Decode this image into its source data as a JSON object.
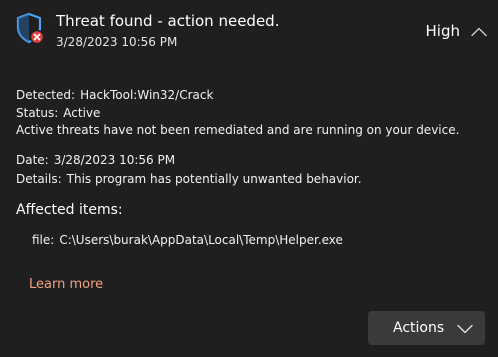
{
  "notification": {
    "title": "Threat found - action needed.",
    "timestamp": "3/28/2023 10:56 PM",
    "severity": "High",
    "icon": "shield-error-icon",
    "collapse_icon": "chevron-up-icon"
  },
  "details": {
    "detected_label": "Detected:",
    "detected_value": "HackTool:Win32/Crack",
    "status_label": "Status:",
    "status_value": "Active",
    "status_description": "Active threats have not been remediated and are running on your device.",
    "date_label": "Date:",
    "date_value": "3/28/2023 10:56 PM",
    "details_label": "Details:",
    "details_value": "This program has potentially unwanted behavior."
  },
  "affected": {
    "title": "Affected items:",
    "items": [
      {
        "label": "file:",
        "path": "C:\\Users\\burak\\AppData\\Local\\Temp\\Helper.exe"
      }
    ]
  },
  "links": {
    "learn_more": "Learn more"
  },
  "actions": {
    "label": "Actions",
    "icon": "chevron-down-icon"
  },
  "colors": {
    "background": "#1f1f1f",
    "shield_blue": "#4aa3f5",
    "error_red": "#e0423a",
    "link": "#f0a080",
    "button_bg": "#3a3a3a"
  }
}
